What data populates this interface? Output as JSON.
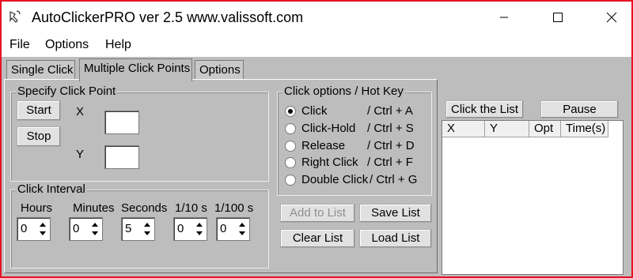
{
  "window": {
    "title": "AutoClickerPRO ver 2.5 www.valissoft.com",
    "icon": "mouse-icon",
    "frame_color": "#e81123"
  },
  "menu": [
    "File",
    "Options",
    "Help"
  ],
  "tabs": [
    {
      "label": "Single Click",
      "active": false
    },
    {
      "label": "Multiple Click Points",
      "active": true
    },
    {
      "label": "Options",
      "active": false
    }
  ],
  "click_point": {
    "title": "Specify Click Point",
    "start_label": "Start",
    "stop_label": "Stop",
    "x_label": "X",
    "y_label": "Y",
    "x_value": "",
    "y_value": ""
  },
  "click_interval": {
    "title": "Click Interval",
    "fields": [
      {
        "label": "Hours",
        "value": "0"
      },
      {
        "label": "Minutes",
        "value": "0"
      },
      {
        "label": "Seconds",
        "value": "5"
      },
      {
        "label": "1/10 s",
        "value": "0"
      },
      {
        "label": "1/100 s",
        "value": "0"
      }
    ]
  },
  "click_options": {
    "title": "Click options / Hot Key",
    "options": [
      {
        "label": "Click",
        "hotkey": "/ Ctrl + A",
        "selected": true
      },
      {
        "label": "Click-Hold",
        "hotkey": "/ Ctrl + S",
        "selected": false
      },
      {
        "label": "Release",
        "hotkey": "/ Ctrl + D",
        "selected": false
      },
      {
        "label": "Right Click",
        "hotkey": "/ Ctrl + F",
        "selected": false
      },
      {
        "label": "Double Click",
        "hotkey": "/ Ctrl + G",
        "selected": false
      }
    ]
  },
  "list_buttons": {
    "add_label": "Add to List",
    "save_label": "Save List",
    "clear_label": "Clear List",
    "load_label": "Load List"
  },
  "list_panel": {
    "click_list_label": "Click the List",
    "pause_label": "Pause",
    "columns": [
      "X",
      "Y",
      "Opt",
      "Time(s)"
    ],
    "rows": []
  }
}
